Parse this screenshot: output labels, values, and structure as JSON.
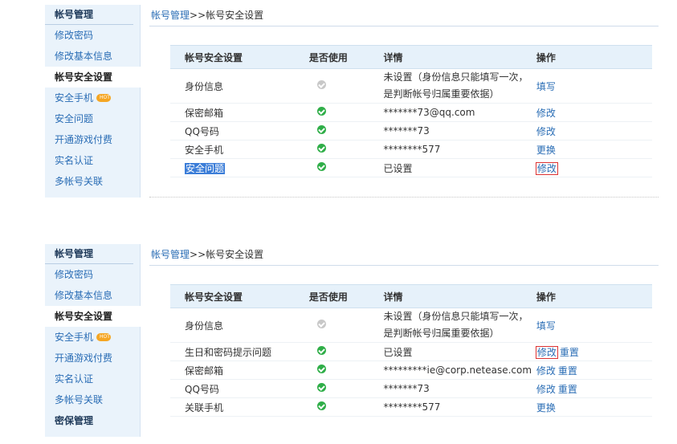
{
  "top": {
    "sidebar": {
      "title": "帐号管理",
      "items": [
        {
          "label": "修改密码"
        },
        {
          "label": "修改基本信息"
        },
        {
          "label": "帐号安全设置"
        },
        {
          "label": "安全手机"
        },
        {
          "label": "安全问题"
        },
        {
          "label": "开通游戏付费"
        },
        {
          "label": "实名认证"
        },
        {
          "label": "多帐号关联"
        }
      ]
    },
    "breadcrumb": {
      "root": "帐号管理",
      "sep": ">>",
      "current": "帐号安全设置"
    },
    "table": {
      "headers": [
        "帐号安全设置",
        "是否使用",
        "详情",
        "操作"
      ],
      "rows": [
        {
          "name": "身份信息",
          "status": "gray-check-icon",
          "detail": "未设置（身份信息只能填写一次，是判断帐号归属重要依据）",
          "ops": [
            "填写"
          ]
        },
        {
          "name": "保密邮箱",
          "status": "green-check-icon",
          "detail": "*******73@qq.com",
          "ops": [
            "修改"
          ]
        },
        {
          "name": "QQ号码",
          "status": "green-check-icon",
          "detail": "*******73",
          "ops": [
            "修改"
          ]
        },
        {
          "name": "安全手机",
          "status": "green-check-icon",
          "detail": "********577",
          "ops": [
            "更换"
          ]
        },
        {
          "name": "安全问题",
          "status": "green-check-icon",
          "detail": "已设置",
          "ops": [
            "修改"
          ]
        }
      ]
    }
  },
  "bottom": {
    "sidebar": {
      "title": "帐号管理",
      "items": [
        {
          "label": "修改密码"
        },
        {
          "label": "修改基本信息"
        },
        {
          "label": "帐号安全设置"
        },
        {
          "label": "安全手机"
        },
        {
          "label": "开通游戏付费"
        },
        {
          "label": "实名认证"
        },
        {
          "label": "多帐号关联"
        },
        {
          "label": "密保管理"
        }
      ]
    },
    "breadcrumb": {
      "root": "帐号管理",
      "sep": ">>",
      "current": "帐号安全设置"
    },
    "table": {
      "headers": [
        "帐号安全设置",
        "是否使用",
        "详情",
        "操作"
      ],
      "rows": [
        {
          "name": "身份信息",
          "status": "gray-check-icon",
          "detail": "未设置（身份信息只能填写一次，是判断帐号归属重要依据）",
          "ops": [
            "填写"
          ]
        },
        {
          "name": "生日和密码提示问题",
          "status": "green-check-icon",
          "detail": "已设置",
          "ops": [
            "修改",
            "重置"
          ]
        },
        {
          "name": "保密邮箱",
          "status": "green-check-icon",
          "detail": "*********ie@corp.netease.com",
          "ops": [
            "修改",
            "重置"
          ]
        },
        {
          "name": "QQ号码",
          "status": "green-check-icon",
          "detail": "*******73",
          "ops": [
            "修改",
            "重置"
          ]
        },
        {
          "name": "关联手机",
          "status": "green-check-icon",
          "detail": "********577",
          "ops": [
            "更换"
          ]
        }
      ]
    }
  }
}
